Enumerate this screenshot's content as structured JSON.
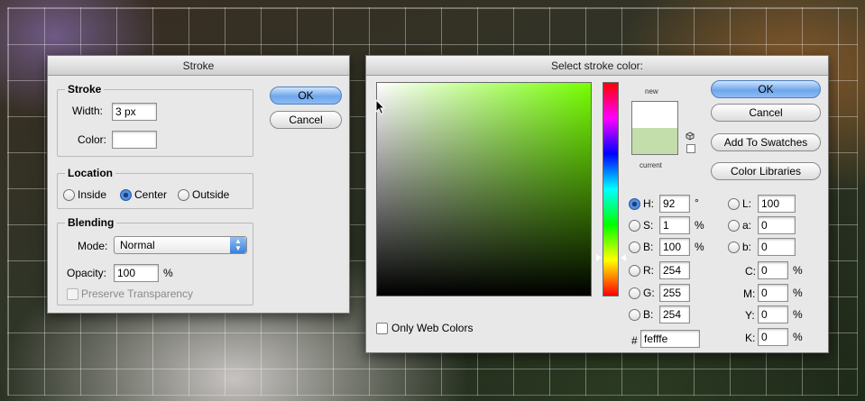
{
  "stroke_dialog": {
    "title": "Stroke",
    "stroke_group": {
      "label": "Stroke",
      "width_label": "Width:",
      "width_value": "3 px",
      "color_label": "Color:"
    },
    "location_group": {
      "label": "Location",
      "options": [
        "Inside",
        "Center",
        "Outside"
      ],
      "selected": "Center"
    },
    "blending_group": {
      "label": "Blending",
      "mode_label": "Mode:",
      "mode_value": "Normal",
      "opacity_label": "Opacity:",
      "opacity_value": "100",
      "opacity_unit": "%",
      "preserve_label": "Preserve Transparency"
    },
    "ok_label": "OK",
    "cancel_label": "Cancel"
  },
  "color_dialog": {
    "title": "Select stroke color:",
    "ok_label": "OK",
    "cancel_label": "Cancel",
    "add_swatches_label": "Add To Swatches",
    "color_libraries_label": "Color Libraries",
    "new_label": "new",
    "current_label": "current",
    "new_color": "#fefffe",
    "current_color": "#c3deaa",
    "web_colors_label": "Only Web Colors",
    "hsb": {
      "h_label": "H:",
      "h_value": "92",
      "h_unit": "°",
      "s_label": "S:",
      "s_value": "1",
      "s_unit": "%",
      "b_label": "B:",
      "b_value": "100",
      "b_unit": "%"
    },
    "rgb": {
      "r_label": "R:",
      "r_value": "254",
      "g_label": "G:",
      "g_value": "255",
      "b_label": "B:",
      "b_value": "254"
    },
    "lab": {
      "l_label": "L:",
      "l_value": "100",
      "a_label": "a:",
      "a_value": "0",
      "b_label": "b:",
      "b_value": "0"
    },
    "cmyk": {
      "c_label": "C:",
      "c_value": "0",
      "m_label": "M:",
      "m_value": "0",
      "y_label": "Y:",
      "y_value": "0",
      "k_label": "K:",
      "k_value": "0",
      "unit": "%"
    },
    "hex_label": "#",
    "hex_value": "fefffe"
  }
}
